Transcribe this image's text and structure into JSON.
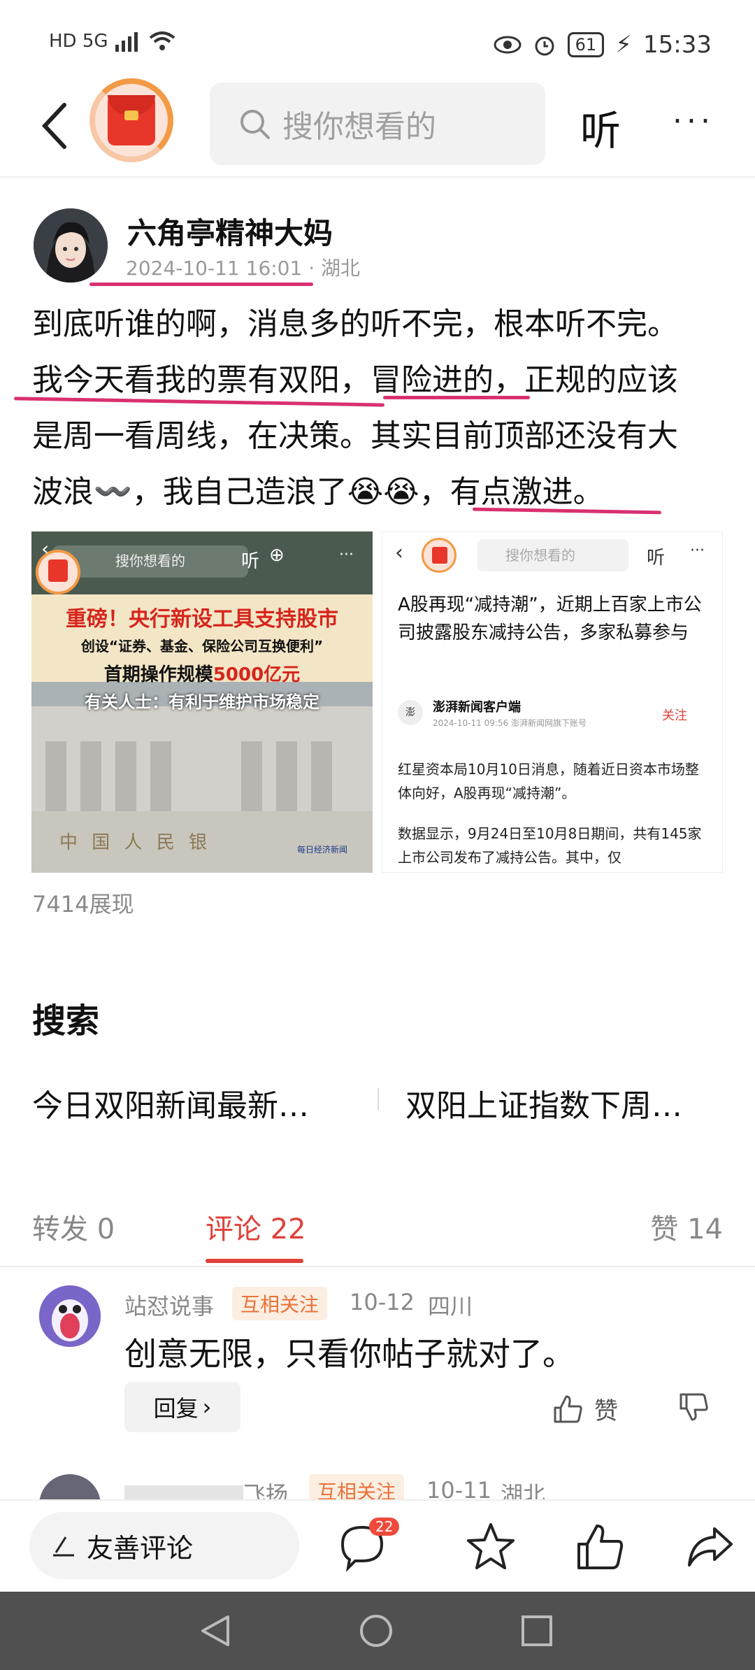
{
  "status_bar": {
    "left": "HD 5G",
    "battery": "61",
    "time": "15:33"
  },
  "top_bar": {
    "search_placeholder": "搜你想看的",
    "listen_label": "听",
    "more_label": "···"
  },
  "post": {
    "author": "六角亭精神大妈",
    "datetime": "2024-10-11 16:01",
    "location_sep": "·",
    "location": "湖北",
    "lines": [
      "到底听谁的啊，消息多的听不完，根本听不完。",
      "我今天看我的票有双阳，冒险进的，正规的应该",
      "是周一看周线，在决策。其实目前顶部还没有大",
      "波浪〰️，我自己造浪了😭😭，有点激进。"
    ],
    "views": "7414展现"
  },
  "image1": {
    "search": "搜你想看的",
    "listen": "听",
    "headline": "重磅！央行新设工具支持股市",
    "line2": "创设“证券、基金、保险公司互换便利”",
    "line3_prefix": "首期操作规模",
    "line3_amount": "5000亿元",
    "line4": "有关人士：有利于维护市场稳定",
    "building_text": "中 国 人 民 银",
    "watermark": "每日经济新闻"
  },
  "image2": {
    "search": "搜你想看的",
    "listen": "听",
    "title": "A股再现“减持潮”，近期上百家上市公司披露股东减持公告，多家私募参与",
    "source": "澎湃新闻客户端",
    "source_meta": "2024-10-11  09:56  澎湃新闻网旗下账号",
    "follow": "关注",
    "p1": "红星资本局10月10日消息，随着近日资本市场整体向好，A股再现“减持潮”。",
    "p2": "数据显示，9月24日至10月8日期间，共有145家上市公司发布了减持公告。其中，仅"
  },
  "search_section": {
    "title": "搜索",
    "suggestions": [
      "今日双阳新闻最新…",
      "双阳上证指数下周…"
    ]
  },
  "tabs": {
    "repost": "转发 0",
    "comment": "评论 22",
    "like": "赞 14"
  },
  "comments": [
    {
      "user": "站怼说事",
      "tag": "互相关注",
      "date": "10-12",
      "location": "四川",
      "text": "创意无限，只看你帖子就对了。",
      "reply_label": "回复",
      "like_label": "赞"
    },
    {
      "user": "飞扬",
      "tag": "互相关注",
      "date": "10-11",
      "location": "湖北"
    }
  ],
  "bottom_bar": {
    "comment_placeholder": "友善评论",
    "comment_count": "22"
  },
  "colors": {
    "accent": "#e0403a",
    "underline": "#d93070",
    "tag": "#e8733a"
  }
}
